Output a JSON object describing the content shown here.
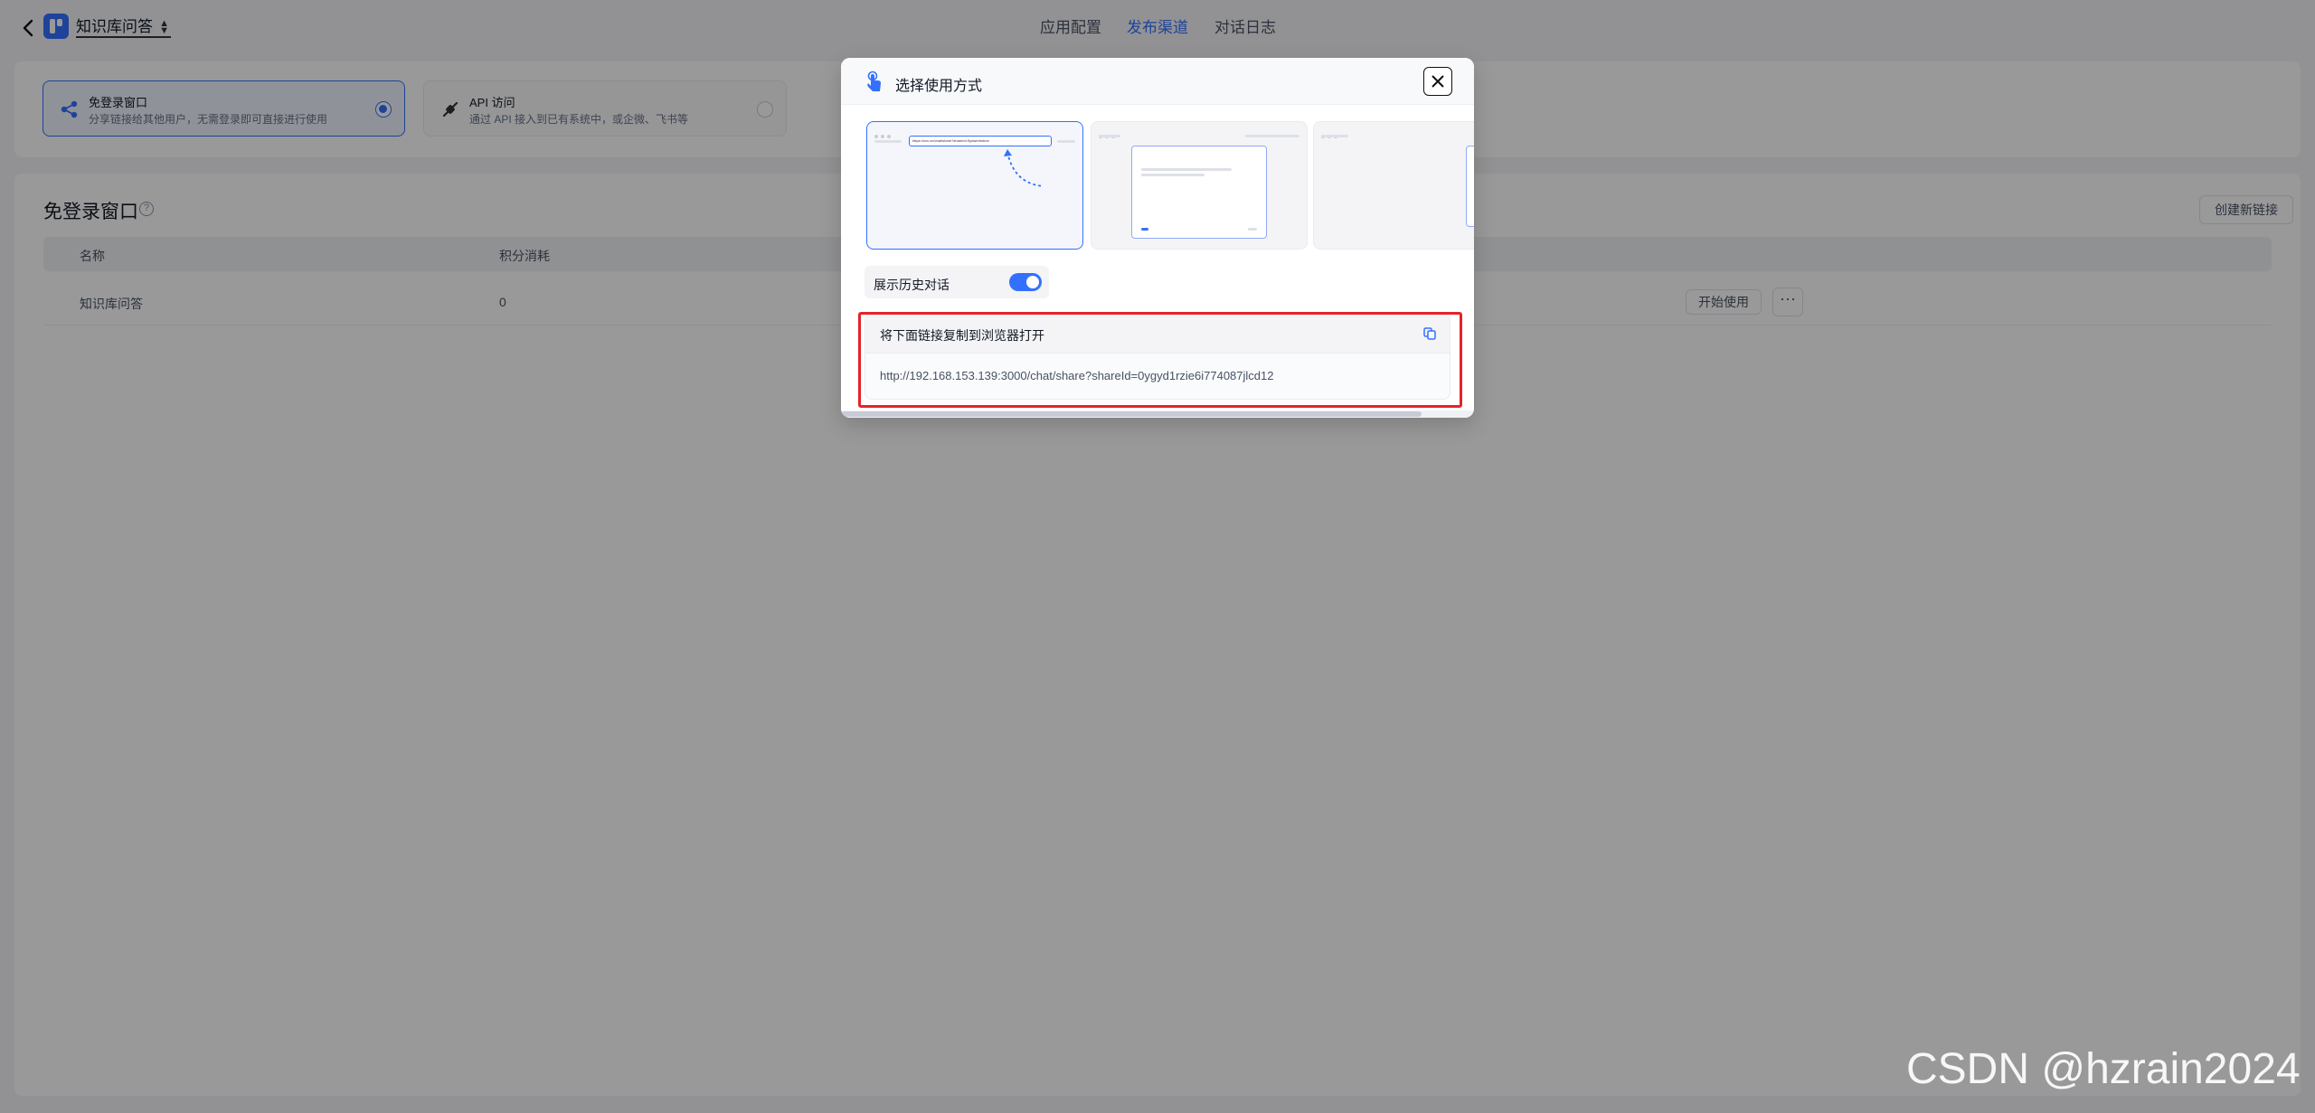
{
  "header": {
    "app_name": "知识库问答",
    "nav": [
      "应用配置",
      "发布渠道",
      "对话日志"
    ],
    "active_nav": "发布渠道"
  },
  "publish_options": [
    {
      "title": "免登录窗口",
      "desc": "分享链接给其他用户，无需登录即可直接进行使用",
      "selected": true,
      "icon": "share-icon"
    },
    {
      "title": "API 访问",
      "desc": "通过 API 接入到已有系统中，或企微、飞书等",
      "selected": false,
      "icon": "api-plug-icon"
    }
  ],
  "section": {
    "title": "免登录窗口",
    "help": "?",
    "create_label": "创建新链接",
    "columns": [
      "名称",
      "积分消耗"
    ],
    "rows": [
      {
        "name": "知识库问答",
        "points": "0",
        "start_label": "开始使用",
        "more_label": "···"
      }
    ]
  },
  "modal": {
    "title": "选择使用方式",
    "toggle_label": "展示历史对话",
    "toggle_on": true,
    "link_title": "将下面链接复制到浏览器打开",
    "link_url": "http://192.168.153.139:3000/chat/share?shareId=0ygyd1rzie6i774087jlcd12",
    "preview_url_text": "https://xxx.cn/chat/share?shareId=9ydwmhnbrw"
  },
  "colors": {
    "accent": "#3370ff",
    "highlight": "#e5232a"
  },
  "watermark": "CSDN @hzrain2024"
}
